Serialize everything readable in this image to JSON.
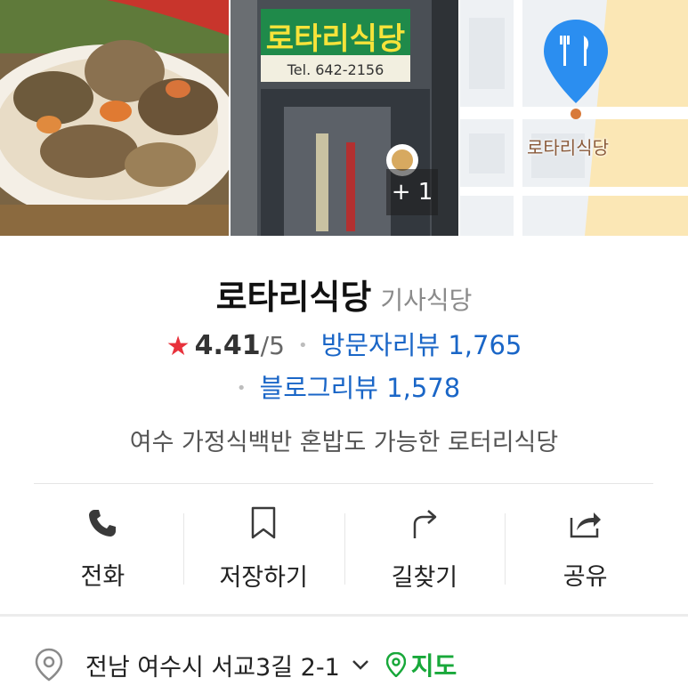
{
  "photos": {
    "more_count": "+ 1",
    "storefront_sign": "로타리식당",
    "storefront_tel": "Tel. 642-2156",
    "map_place_label": "로타리식당"
  },
  "place": {
    "name": "로타리식당",
    "category": "기사식당",
    "rating": "4.41",
    "rating_max": "/5",
    "visitor_reviews": "방문자리뷰 1,765",
    "blog_reviews": "블로그리뷰 1,578",
    "description": "여수 가정식백반 혼밥도 가능한 로터리식당"
  },
  "actions": [
    {
      "label": "전화",
      "icon": "phone-icon"
    },
    {
      "label": "저장하기",
      "icon": "bookmark-icon"
    },
    {
      "label": "길찾기",
      "icon": "directions-icon"
    },
    {
      "label": "공유",
      "icon": "share-icon"
    }
  ],
  "address": {
    "text": "전남 여수시 서교3길 2-1",
    "map_link": "지도"
  },
  "colors": {
    "star": "#e8323c",
    "link_blue": "#1a66c7",
    "map_green": "#18a83a",
    "map_marker_blue": "#2b8ef0"
  }
}
